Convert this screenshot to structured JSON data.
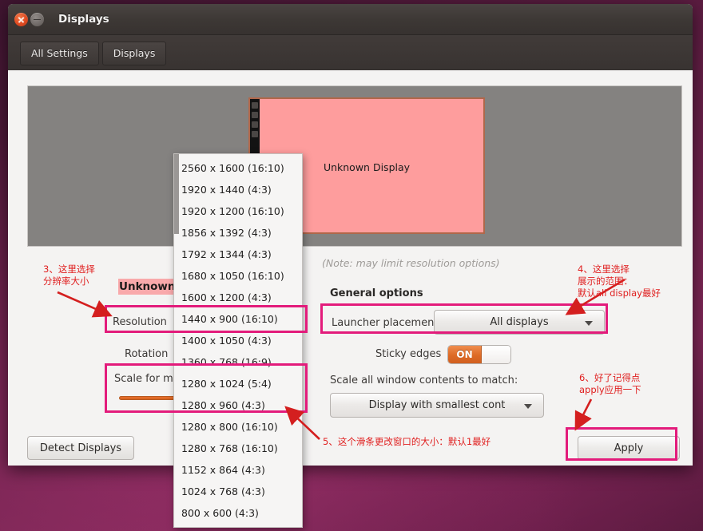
{
  "window": {
    "title": "Displays",
    "close_icon": "close-icon",
    "minimize_icon": "minimize-icon"
  },
  "toolbar": {
    "all_settings_label": "All Settings",
    "displays_label": "Displays"
  },
  "preview": {
    "monitor_label": "Unknown Display"
  },
  "settings": {
    "display_name": "Unknown Di",
    "resolution_label": "Resolution",
    "rotation_label": "Rotation",
    "scale_label": "Scale for men",
    "scale_value": "1",
    "note": "(Note: may limit resolution options)",
    "general_options_title": "General options",
    "launcher_placement_label": "Launcher placement",
    "launcher_placement_value": "All displays",
    "sticky_edges_label": "Sticky edges",
    "sticky_edges_state": "ON",
    "scale_all_label": "Scale all window contents to match:",
    "scale_all_value": "Display with smallest cont"
  },
  "buttons": {
    "detect_displays": "Detect Displays",
    "apply": "Apply"
  },
  "dropdown": {
    "selected": "1440 x 900 (16:10)",
    "items": [
      "2560 x 1600 (16:10)",
      "1920 x 1440 (4:3)",
      "1920 x 1200 (16:10)",
      "1856 x 1392 (4:3)",
      "1792 x 1344 (4:3)",
      "1680 x 1050 (16:10)",
      "1600 x 1200 (4:3)",
      "1440 x 900 (16:10)",
      "1400 x 1050 (4:3)",
      "1360 x 768 (16:9)",
      "1280 x 1024 (5:4)",
      "1280 x 960 (4:3)",
      "1280 x 800 (16:10)",
      "1280 x 768 (16:10)",
      "1152 x 864 (4:3)",
      "1024 x 768 (4:3)",
      "800 x 600 (4:3)"
    ]
  },
  "annotations": {
    "note3": "3、这里选择\n分辨率大小",
    "note4": "4、这里选择\n展示的范围：\n默认all display最好",
    "note5": "5、这个滑条更改窗口的大小：默认1最好",
    "note6": "6、好了记得点\napply应用一下"
  },
  "colors": {
    "annotation_red": "#e02020",
    "highlight_box": "#e31b7b",
    "monitor_fill": "#fe9d9d",
    "toggle_on": "#dd6a26",
    "desktop": "#661f47"
  }
}
